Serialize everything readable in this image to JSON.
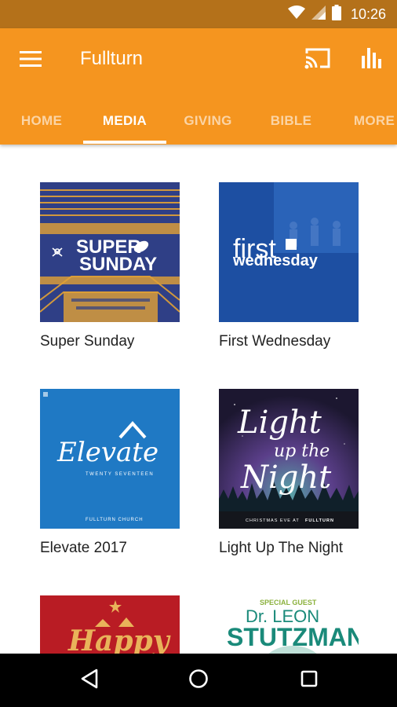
{
  "status_bar": {
    "time": "10:26"
  },
  "app_bar": {
    "title": "Fullturn",
    "tabs": [
      {
        "label": "HOME"
      },
      {
        "label": "MEDIA"
      },
      {
        "label": "GIVING"
      },
      {
        "label": "BIBLE"
      },
      {
        "label": "MORE"
      }
    ],
    "active_tab": "MEDIA"
  },
  "media": {
    "items": [
      {
        "title": "Super Sunday",
        "art_text": [
          "SUPER",
          "SUNDAY"
        ]
      },
      {
        "title": "First Wednesday",
        "art_text": [
          "first",
          "wednesday"
        ]
      },
      {
        "title": "Elevate 2017",
        "art_text": [
          "Elevate",
          "TWENTY SEVENTEEN",
          "FULLTURN CHURCH"
        ]
      },
      {
        "title": "Light Up The Night",
        "art_text": [
          "Light",
          "up the",
          "Night",
          "CHRISTMAS EVE AT",
          "FULLTURN"
        ]
      },
      {
        "title": "",
        "art_text": [
          "Happy"
        ]
      },
      {
        "title": "",
        "art_text": [
          "SPECIAL GUEST",
          "Dr. LEON",
          "STUTZMAN"
        ]
      }
    ]
  },
  "colors": {
    "primary": "#f5951f",
    "status_bar": "#b4711a",
    "super_sunday": "#2f3f86",
    "first_wednesday": "#1d4fa2",
    "elevate": "#1f79c4",
    "light_up_night": "#2a2348",
    "happy": "#b91c24",
    "stutzman": "#1a8a7a"
  }
}
